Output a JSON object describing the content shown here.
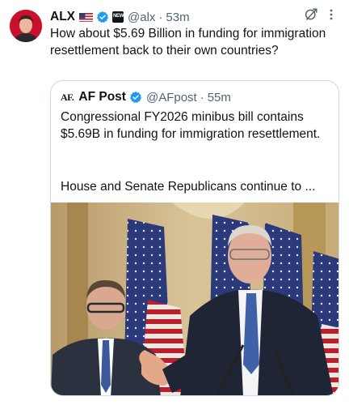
{
  "tweet": {
    "author_name": "ALX",
    "author_handle": "@alx",
    "separator": "·",
    "time": "53m",
    "text": "How about $5.69 Billion in funding for immigration resettlement back to their own countries?",
    "icons": [
      "us-flag-icon",
      "verified-badge-icon",
      "affiliate-badge-icon",
      "grok-icon",
      "more-options-icon"
    ]
  },
  "quote": {
    "logo": "AF.",
    "author_name": "AF Post",
    "author_handle": "@AFpost",
    "separator": "·",
    "time": "55m",
    "text": "Congressional FY2026 minibus bill contains $5.69B in funding for immigration resettlement.",
    "text_more": "House and Senate Republicans continue to ...",
    "image_subject": "press-conference-photo"
  },
  "colors": {
    "text": "#0f1419",
    "secondary": "#536471",
    "verified": "#1d9bf0",
    "border": "#cfd9de",
    "avatar_bg": "#c8102e"
  }
}
